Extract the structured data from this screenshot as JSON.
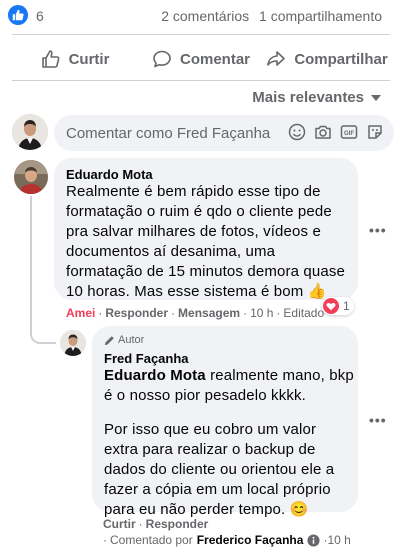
{
  "stats": {
    "like_count": "6",
    "comments": "2 comentários",
    "shares": "1 compartilhamento"
  },
  "actions": {
    "like": "Curtir",
    "comment": "Comentar",
    "share": "Compartilhar"
  },
  "sort": {
    "label": "Mais relevantes"
  },
  "composer": {
    "placeholder": "Comentar como Fred Façanha"
  },
  "comment1": {
    "author": "Eduardo Mota",
    "text_lines": [
      "Realmente é bem rápido esse tipo de",
      "formatação o ruim é qdo o cliente pede",
      "pra salvar milhares de fotos, vídeos e",
      "documentos aí desanima, uma",
      "formatação de 15 minutos demora quase",
      "10 horas. Mas esse sistema é bom"
    ],
    "emoji": "👍",
    "reaction_count": "1",
    "actions": {
      "reaction": "Amei",
      "reply": "Responder",
      "message": "Mensagem",
      "time": "10 h",
      "edited": "Editado"
    }
  },
  "reply1": {
    "badge": "Autor",
    "author": "Fred Façanha",
    "mention": "Eduardo Mota",
    "para1_first": " realmente mano, bkp",
    "para1_line2": "é o nosso pior pesadelo kkkk.",
    "para2_lines": [
      "Por isso que eu cobro um valor",
      "extra para realizar o backup de",
      "dados do cliente ou orientou ele a",
      "fazer a cópia em um local próprio",
      "para eu não perder tempo."
    ],
    "emoji": "😊",
    "actions": {
      "like": "Curtir",
      "reply": "Responder"
    },
    "footer_prefix": "Comentado por",
    "footer_author": "Frederico Façanha"
  },
  "colors": {
    "facebook_blue": "#1877f2",
    "love_red": "#f33e58",
    "text_secondary": "#65676b",
    "bubble_bg": "#f0f2f5"
  }
}
